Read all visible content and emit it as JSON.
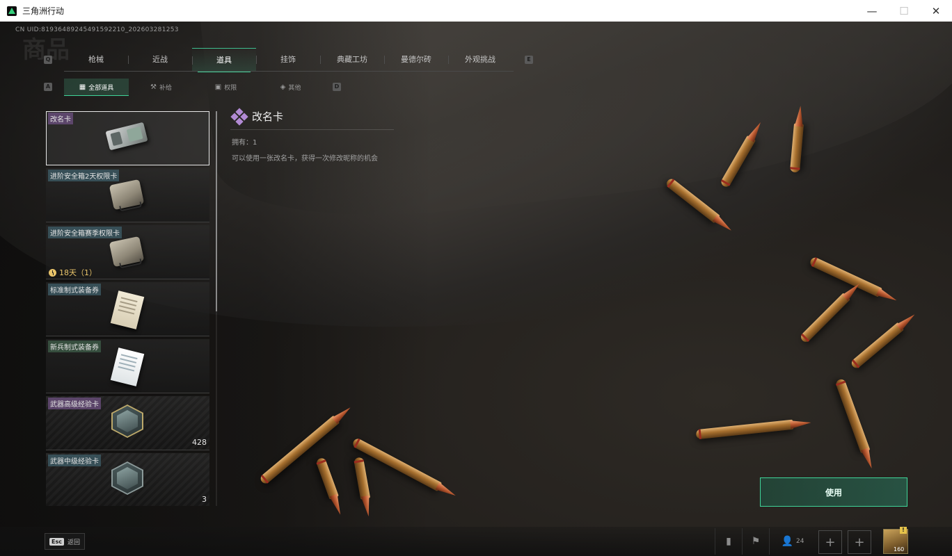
{
  "window": {
    "title": "三角洲行动",
    "minimize_glyph": "—",
    "maximize_glyph": "☐",
    "close_glyph": "✕"
  },
  "header": {
    "uid": "CN UID:8193648924549159221‌0_202603281253",
    "ghost_title": "商品"
  },
  "key_hints": {
    "main_left": "Q",
    "main_right": "E",
    "sub_left": "A",
    "sub_right": "D"
  },
  "main_tabs": [
    {
      "label": "枪械",
      "active": false
    },
    {
      "label": "近战",
      "active": false
    },
    {
      "label": "道具",
      "active": true
    },
    {
      "label": "挂饰",
      "active": false
    },
    {
      "label": "典藏工坊",
      "active": false
    },
    {
      "label": "曼德尔砖",
      "active": false
    },
    {
      "label": "外观挑战",
      "active": false
    }
  ],
  "sub_tabs": [
    {
      "label": "全部道具",
      "icon": "grid-icon",
      "glyph": "▦",
      "active": true
    },
    {
      "label": "补给",
      "icon": "supply-icon",
      "glyph": "⚒",
      "active": false
    },
    {
      "label": "权限",
      "icon": "permission-icon",
      "glyph": "▣",
      "active": false
    },
    {
      "label": "其他",
      "icon": "other-icon",
      "glyph": "◈",
      "active": false
    }
  ],
  "items": [
    {
      "name": "改名卡",
      "tag_color": "purple",
      "icon": "rename-card-icon",
      "count": "",
      "selected": true
    },
    {
      "name": "进阶安全箱2天权限卡",
      "tag_color": "teal",
      "icon": "secure-case-icon",
      "count": "",
      "selected": false
    },
    {
      "name": "进阶安全箱赛季权限卡",
      "tag_color": "teal",
      "icon": "secure-case-icon",
      "count": "",
      "selected": false
    },
    {
      "name": "标准制式装备券",
      "tag_color": "teal",
      "icon": "standard-voucher-icon",
      "count": "",
      "selected": false
    },
    {
      "name": "新兵制式装备券",
      "tag_color": "green",
      "icon": "recruit-voucher-icon",
      "count": "",
      "selected": false
    },
    {
      "name": "武器高级经验卡",
      "tag_color": "purple",
      "icon": "weapon-exp-advanced-icon",
      "count": "428",
      "selected": false
    },
    {
      "name": "武器中级经验卡",
      "tag_color": "teal",
      "icon": "weapon-exp-intermediate-icon",
      "count": "3",
      "selected": false
    }
  ],
  "timer_badge": "18天（1）",
  "detail": {
    "title": "改名卡",
    "owned": "拥有：1",
    "description": "可以使用一张改名卡，获得一次修改昵称的机会"
  },
  "use_button": "使用",
  "bottom_bar": {
    "esc_key": "Esc",
    "esc_label": "返回",
    "friends_count": "24",
    "avatar_badge": "!",
    "avatar_level": "160"
  },
  "colors": {
    "accent": "#3fd69a",
    "timer": "#e9c46a",
    "tag_purple": "#6e5082",
    "tag_teal": "#3c5a64"
  }
}
